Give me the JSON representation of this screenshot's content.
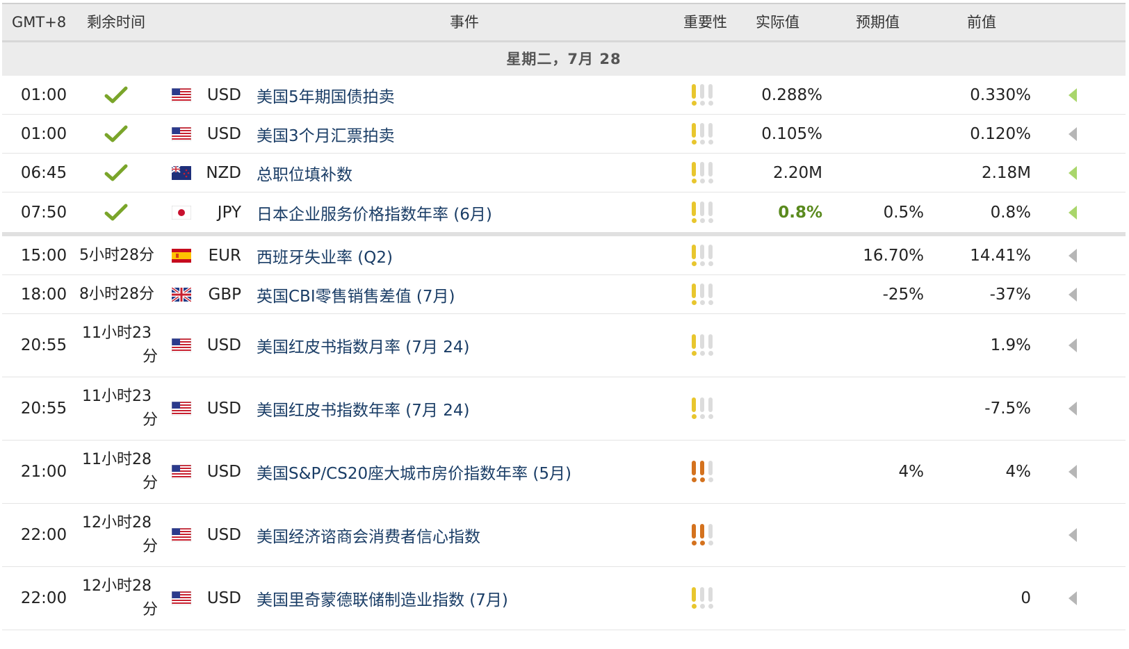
{
  "header": {
    "tz": "GMT+8",
    "remaining": "剩余时间",
    "event": "事件",
    "importance": "重要性",
    "actual": "实际值",
    "forecast": "预期值",
    "previous": "前值"
  },
  "day_label": "星期二，7月 28",
  "colors": {
    "event_link": "#1a3d66",
    "actual_better": "#5a8a1e",
    "bull_low": "#e8c62e",
    "bull_high": "#d4721e",
    "released_arrow": "#a9d66b"
  },
  "rows": [
    {
      "time": "01:00",
      "remaining": "",
      "done": true,
      "flag": "us-flag-icon",
      "currency": "USD",
      "event": "美国5年期国债拍卖",
      "importance": 1,
      "actual": "0.288%",
      "actual_color": "",
      "forecast": "",
      "previous": "0.330%",
      "released": true
    },
    {
      "time": "01:00",
      "remaining": "",
      "done": true,
      "flag": "us-flag-icon",
      "currency": "USD",
      "event": "美国3个月汇票拍卖",
      "importance": 1,
      "actual": "0.105%",
      "actual_color": "",
      "forecast": "",
      "previous": "0.120%",
      "released": false
    },
    {
      "time": "06:45",
      "remaining": "",
      "done": true,
      "flag": "nz-flag-icon",
      "currency": "NZD",
      "event": "总职位填补数",
      "importance": 1,
      "actual": "2.20M",
      "actual_color": "",
      "forecast": "",
      "previous": "2.18M",
      "released": true
    },
    {
      "time": "07:50",
      "remaining": "",
      "done": true,
      "flag": "jp-flag-icon",
      "currency": "JPY",
      "event": "日本企业服务价格指数年率 (6月)",
      "importance": 1,
      "actual": "0.8%",
      "actual_color": "green",
      "forecast": "0.5%",
      "previous": "0.8%",
      "released": true
    },
    {
      "time": "15:00",
      "remaining": "5小时28分",
      "done": false,
      "flag": "es-flag-icon",
      "currency": "EUR",
      "event": "西班牙失业率 (Q2)",
      "importance": 1,
      "actual": "",
      "actual_color": "",
      "forecast": "16.70%",
      "previous": "14.41%",
      "released": false
    },
    {
      "time": "18:00",
      "remaining": "8小时28分",
      "done": false,
      "flag": "gb-flag-icon",
      "currency": "GBP",
      "event": "英国CBI零售销售差值 (7月)",
      "importance": 1,
      "actual": "",
      "actual_color": "",
      "forecast": "-25%",
      "previous": "-37%",
      "released": false
    },
    {
      "time": "20:55",
      "remaining": "11小时23",
      "remaining2": "分",
      "done": false,
      "flag": "us-flag-icon",
      "currency": "USD",
      "event": "美国红皮书指数月率 (7月 24)",
      "importance": 1,
      "actual": "",
      "actual_color": "",
      "forecast": "",
      "previous": "1.9%",
      "released": false
    },
    {
      "time": "20:55",
      "remaining": "11小时23",
      "remaining2": "分",
      "done": false,
      "flag": "us-flag-icon",
      "currency": "USD",
      "event": "美国红皮书指数年率 (7月 24)",
      "importance": 1,
      "actual": "",
      "actual_color": "",
      "forecast": "",
      "previous": "-7.5%",
      "released": false
    },
    {
      "time": "21:00",
      "remaining": "11小时28",
      "remaining2": "分",
      "done": false,
      "flag": "us-flag-icon",
      "currency": "USD",
      "event": "美国S&P/CS20座大城市房价指数年率 (5月)",
      "importance": 2,
      "actual": "",
      "actual_color": "",
      "forecast": "4%",
      "previous": "4%",
      "released": false
    },
    {
      "time": "22:00",
      "remaining": "12小时28",
      "remaining2": "分",
      "done": false,
      "flag": "us-flag-icon",
      "currency": "USD",
      "event": "美国经济谘商会消费者信心指数",
      "importance": 2,
      "actual": "",
      "actual_color": "",
      "forecast": "",
      "previous": "",
      "released": false
    },
    {
      "time": "22:00",
      "remaining": "12小时28",
      "remaining2": "分",
      "done": false,
      "flag": "us-flag-icon",
      "currency": "USD",
      "event": "美国里奇蒙德联储制造业指数 (7月)",
      "importance": 1,
      "actual": "",
      "actual_color": "",
      "forecast": "",
      "previous": "0",
      "released": false
    }
  ]
}
